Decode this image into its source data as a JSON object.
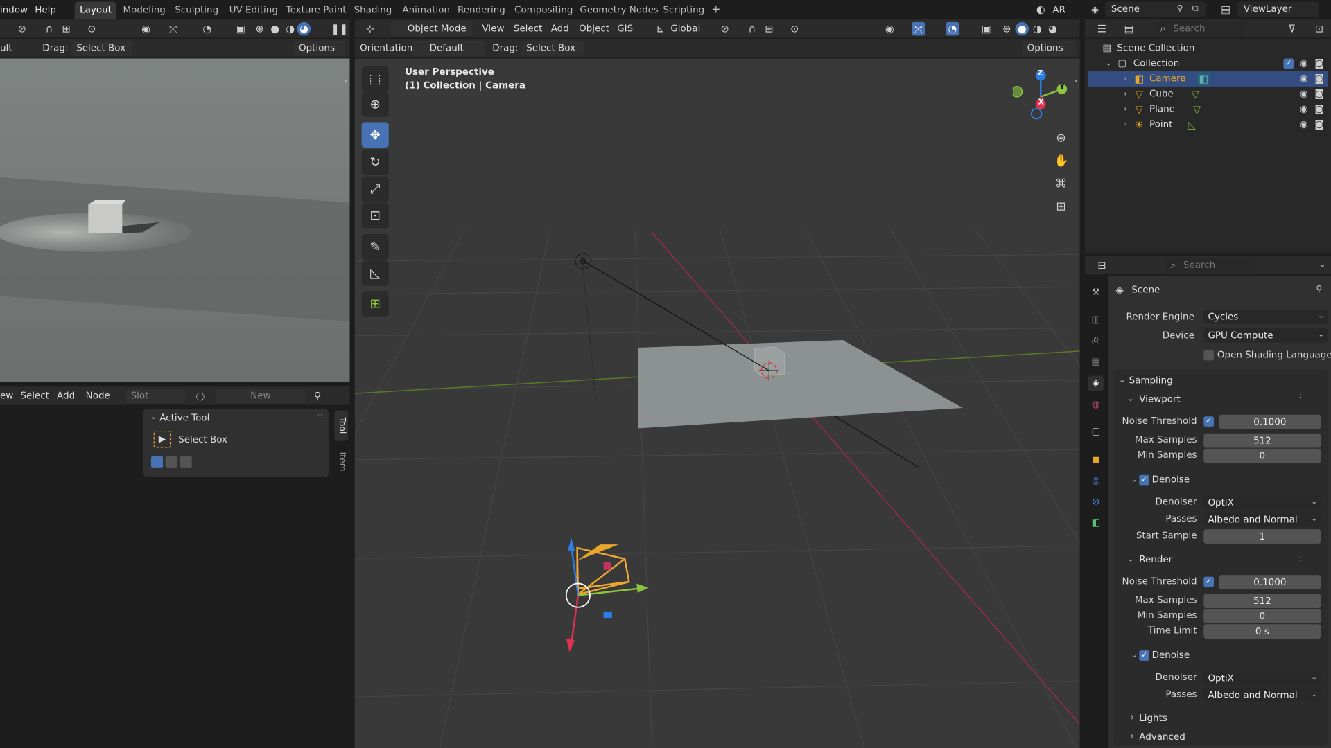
{
  "menu": {
    "window": "indow",
    "help": "Help"
  },
  "workspaces": [
    "Layout",
    "Modeling",
    "Sculpting",
    "UV Editing",
    "Texture Paint",
    "Shading",
    "Animation",
    "Rendering",
    "Compositing",
    "Geometry Nodes",
    "Scripting",
    "+"
  ],
  "topright": {
    "ar": "AR",
    "scene": "Scene",
    "viewlayer": "ViewLayer"
  },
  "left_header": {
    "mode_suffix": "ult",
    "drag_label": "Drag:",
    "drag_value": "Select Box",
    "options": "Options"
  },
  "node_header": {
    "view_suffix": "ew",
    "select": "Select",
    "add": "Add",
    "node": "Node",
    "slot": "Slot",
    "new": "New"
  },
  "active_tool": {
    "title": "Active Tool",
    "tool_name": "Select Box",
    "tab_tool": "Tool",
    "tab_item": "Item"
  },
  "viewport": {
    "mode": "Object Mode",
    "view": "View",
    "select": "Select",
    "add": "Add",
    "object": "Object",
    "gis": "GIS",
    "transform": "Global",
    "orientation_label": "Orientation:",
    "orientation_value": "Default",
    "drag_label": "Drag:",
    "drag_value": "Select Box",
    "options": "Options",
    "overlay_title": "User Perspective",
    "overlay_sub": "(1) Collection | Camera",
    "gizmo_axes": {
      "z": "Z",
      "y": "Y",
      "x": "X"
    }
  },
  "outliner": {
    "search_placeholder": "Search",
    "scene_collection": "Scene Collection",
    "collection": "Collection",
    "items": [
      {
        "name": "Camera",
        "icon": "camera-icon"
      },
      {
        "name": "Cube",
        "icon": "mesh-icon"
      },
      {
        "name": "Plane",
        "icon": "mesh-icon"
      },
      {
        "name": "Point",
        "icon": "light-icon"
      }
    ]
  },
  "properties": {
    "search_placeholder": "Search",
    "context": "Scene",
    "render_engine_label": "Render Engine",
    "render_engine": "Cycles",
    "device_label": "Device",
    "device": "GPU Compute",
    "osl": "Open Shading Language",
    "sampling": "Sampling",
    "viewport_section": "Viewport",
    "render_section": "Render",
    "vp": {
      "noise_label": "Noise Threshold",
      "noise": "0.1000",
      "max_label": "Max Samples",
      "max": "512",
      "min_label": "Min Samples",
      "min": "0",
      "denoise": "Denoise",
      "denoiser_label": "Denoiser",
      "denoiser": "OptiX",
      "passes_label": "Passes",
      "passes": "Albedo and Normal",
      "start_label": "Start Sample",
      "start": "1"
    },
    "rd": {
      "noise_label": "Noise Threshold",
      "noise": "0.1000",
      "max_label": "Max Samples",
      "max": "512",
      "min_label": "Min Samples",
      "min": "0",
      "time_label": "Time Limit",
      "time": "0 s",
      "denoise": "Denoise",
      "denoiser_label": "Denoiser",
      "denoiser": "OptiX",
      "passes_label": "Passes",
      "passes": "Albedo and Normal"
    },
    "lights": "Lights",
    "advanced": "Advanced"
  },
  "colors": {
    "accent": "#4772b3",
    "x_axis": "#e0324f",
    "y_axis": "#8bc53f",
    "z_axis": "#2d7de8",
    "camera": "#e8a52b"
  }
}
